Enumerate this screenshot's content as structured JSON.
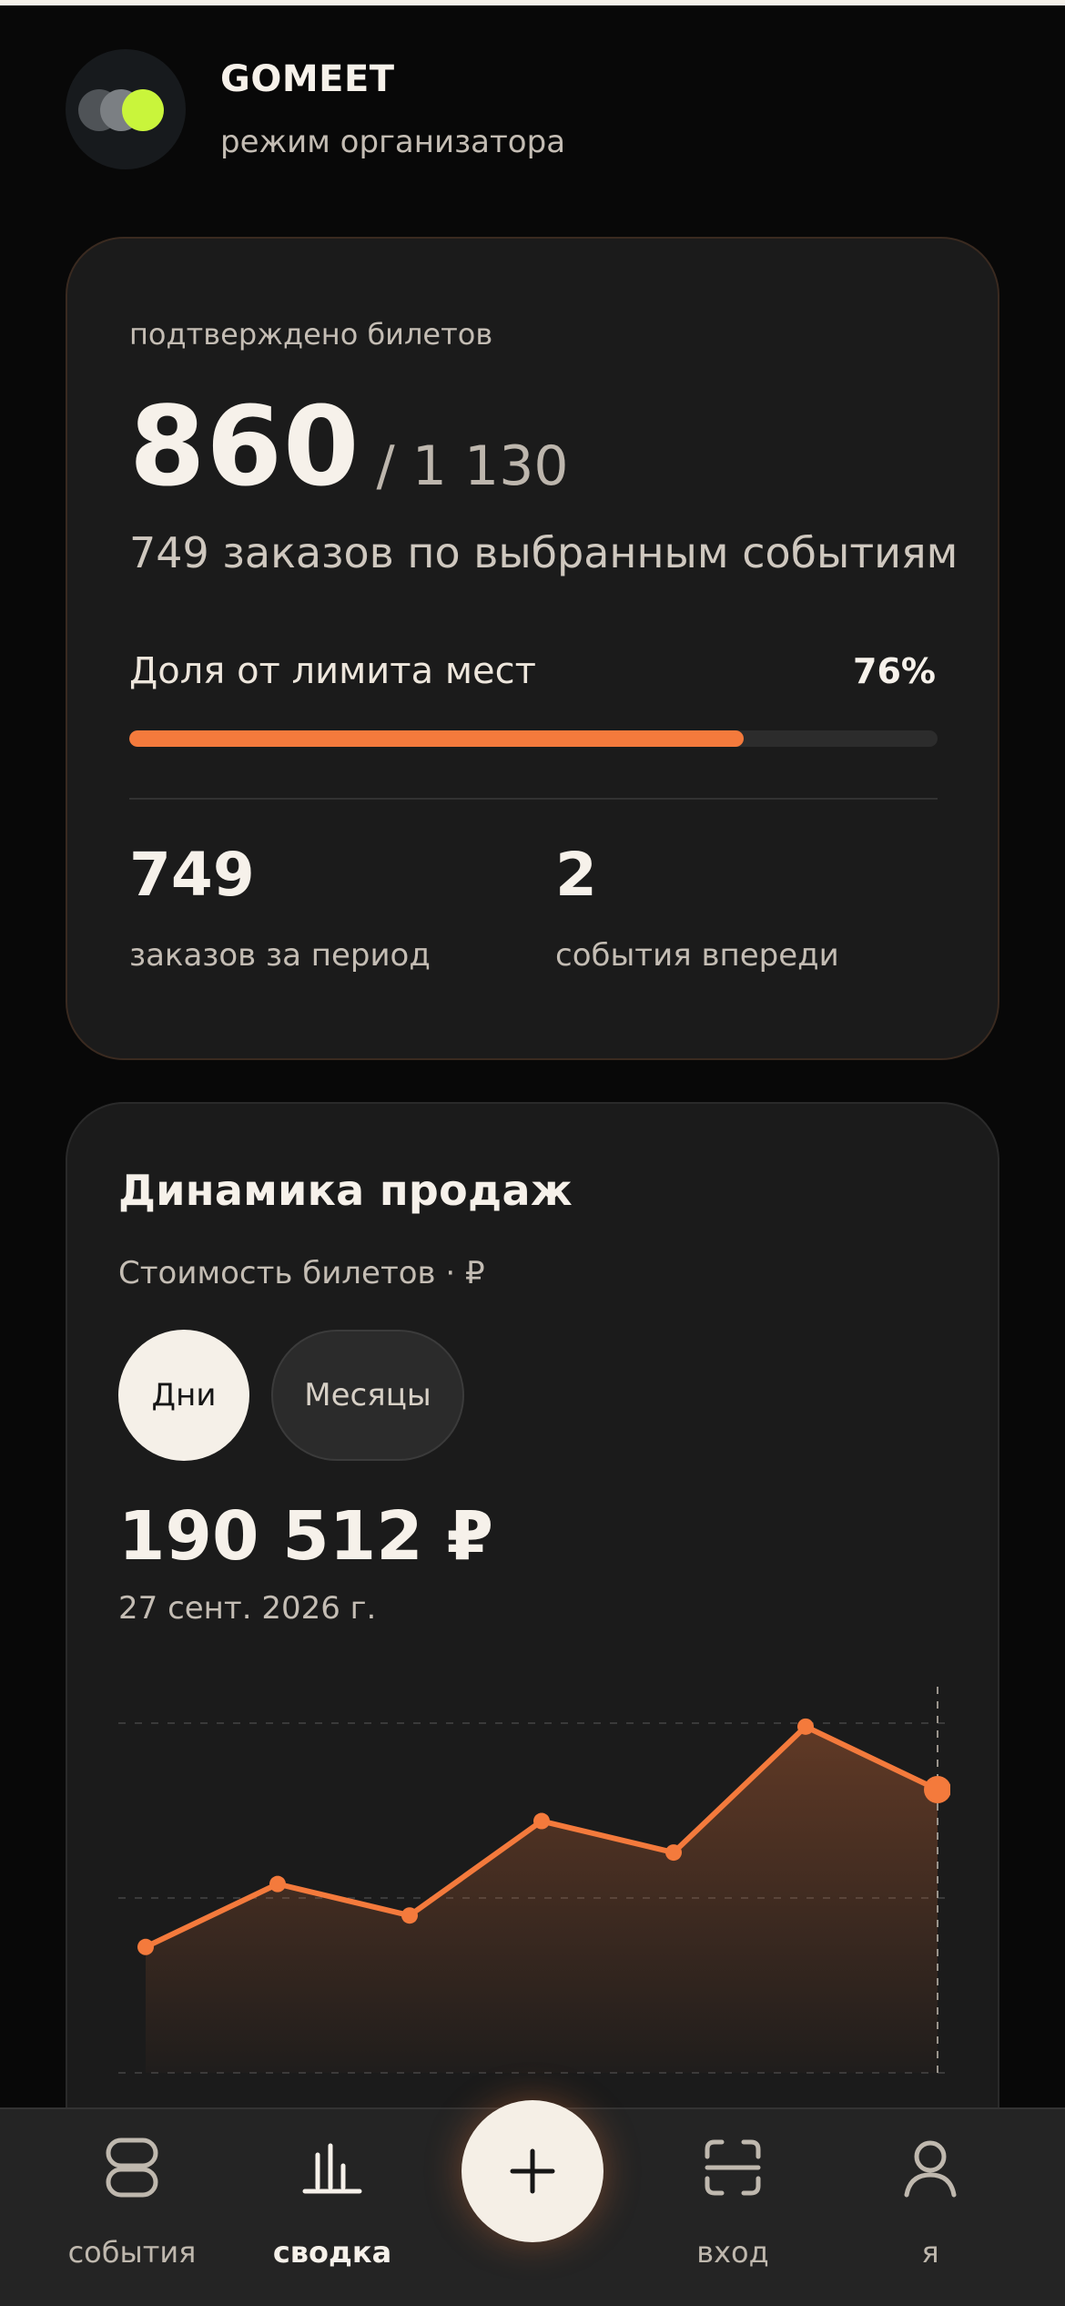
{
  "brand": {
    "name": "GOMEET",
    "mode": "режим организатора"
  },
  "tickets": {
    "label": "подтверждено билетов",
    "confirmed": "860",
    "total": "/ 1 130",
    "orders_line": "749 заказов по выбранным событиям",
    "share_label": "Доля от лимита мест",
    "share_pct_text": "76%",
    "share_fraction": 0.76
  },
  "stats": [
    {
      "value": "749",
      "label": "заказов за период"
    },
    {
      "value": "2",
      "label": "события впереди"
    }
  ],
  "sales": {
    "title": "Динамика продаж",
    "subtitle": "Стоимость билетов · ₽",
    "toggle_days": "Дни",
    "toggle_months": "Месяцы",
    "selected_toggle": "Дни",
    "amount": "190 512 ₽",
    "date": "27 сент. 2026 г."
  },
  "chart_data": {
    "type": "area",
    "title": "",
    "xlabel": "",
    "ylabel": "",
    "ylim": [
      0,
      100
    ],
    "grid": true,
    "series": [
      {
        "values": [
          36,
          54,
          45,
          72,
          63,
          99,
          81
        ]
      }
    ],
    "highlight_index": 6,
    "colors": {
      "line": "#f47a3c",
      "fill": "#f47a3c"
    }
  },
  "nav": {
    "events": "события",
    "summary": "сводка",
    "entry": "вход",
    "me": "я",
    "active": "сводка"
  },
  "icons": {
    "logo": "three-circles-logo",
    "events": "events-icon",
    "summary": "bar-chart-icon",
    "add": "plus-icon",
    "entry": "scan-icon",
    "me": "user-icon"
  }
}
